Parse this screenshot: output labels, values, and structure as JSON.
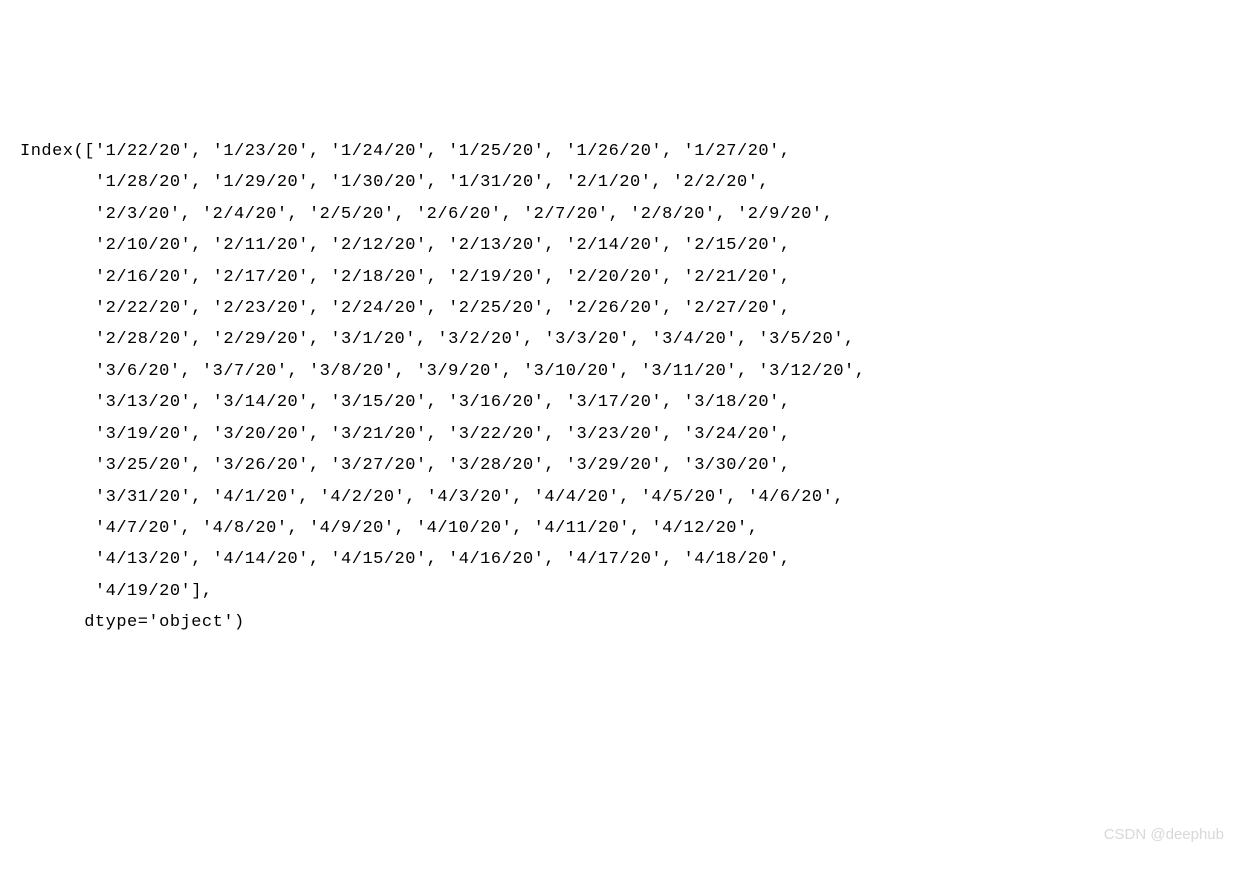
{
  "output": {
    "prefix": "Index([",
    "dates": [
      "1/22/20",
      "1/23/20",
      "1/24/20",
      "1/25/20",
      "1/26/20",
      "1/27/20",
      "1/28/20",
      "1/29/20",
      "1/30/20",
      "1/31/20",
      "2/1/20",
      "2/2/20",
      "2/3/20",
      "2/4/20",
      "2/5/20",
      "2/6/20",
      "2/7/20",
      "2/8/20",
      "2/9/20",
      "2/10/20",
      "2/11/20",
      "2/12/20",
      "2/13/20",
      "2/14/20",
      "2/15/20",
      "2/16/20",
      "2/17/20",
      "2/18/20",
      "2/19/20",
      "2/20/20",
      "2/21/20",
      "2/22/20",
      "2/23/20",
      "2/24/20",
      "2/25/20",
      "2/26/20",
      "2/27/20",
      "2/28/20",
      "2/29/20",
      "3/1/20",
      "3/2/20",
      "3/3/20",
      "3/4/20",
      "3/5/20",
      "3/6/20",
      "3/7/20",
      "3/8/20",
      "3/9/20",
      "3/10/20",
      "3/11/20",
      "3/12/20",
      "3/13/20",
      "3/14/20",
      "3/15/20",
      "3/16/20",
      "3/17/20",
      "3/18/20",
      "3/19/20",
      "3/20/20",
      "3/21/20",
      "3/22/20",
      "3/23/20",
      "3/24/20",
      "3/25/20",
      "3/26/20",
      "3/27/20",
      "3/28/20",
      "3/29/20",
      "3/30/20",
      "3/31/20",
      "4/1/20",
      "4/2/20",
      "4/3/20",
      "4/4/20",
      "4/5/20",
      "4/6/20",
      "4/7/20",
      "4/8/20",
      "4/9/20",
      "4/10/20",
      "4/11/20",
      "4/12/20",
      "4/13/20",
      "4/14/20",
      "4/15/20",
      "4/16/20",
      "4/17/20",
      "4/18/20",
      "4/19/20"
    ],
    "row_breaks": [
      6,
      12,
      19,
      25,
      31,
      37,
      44,
      51,
      57,
      63,
      69,
      76,
      82,
      88,
      89
    ],
    "suffix_close": "],",
    "dtype_line": "      dtype='object')"
  },
  "watermark": "CSDN @deephub"
}
